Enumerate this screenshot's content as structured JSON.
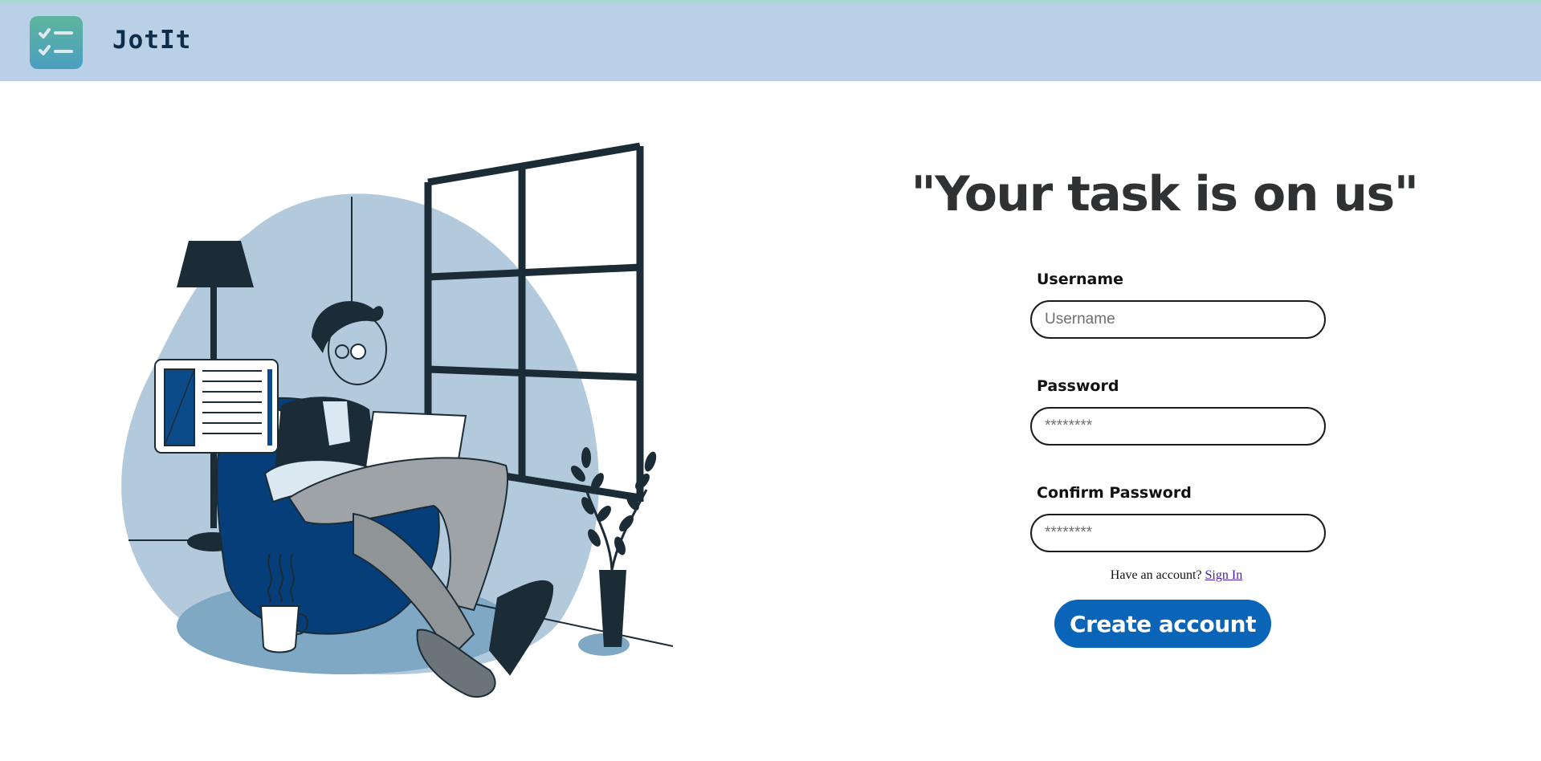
{
  "app": {
    "name": "JotIt"
  },
  "hero": {
    "headline": "\"Your task is on us\""
  },
  "form": {
    "username": {
      "label": "Username",
      "placeholder": "Username",
      "value": ""
    },
    "password": {
      "label": "Password",
      "placeholder": "********",
      "value": ""
    },
    "confirm_password": {
      "label": "Confirm Password",
      "placeholder": "********",
      "value": ""
    },
    "signin_prompt": "Have an account?",
    "signin_link": "Sign In",
    "submit_label": "Create account"
  },
  "icons": {
    "logo": "checklist-icon",
    "illustration": "person-reading-illustration"
  },
  "colors": {
    "header_bg": "#b9d0e6",
    "brand_text": "#0e2d4a",
    "primary_button": "#0a64b8",
    "headline": "#2f3133",
    "link": "#4b1fa3"
  }
}
